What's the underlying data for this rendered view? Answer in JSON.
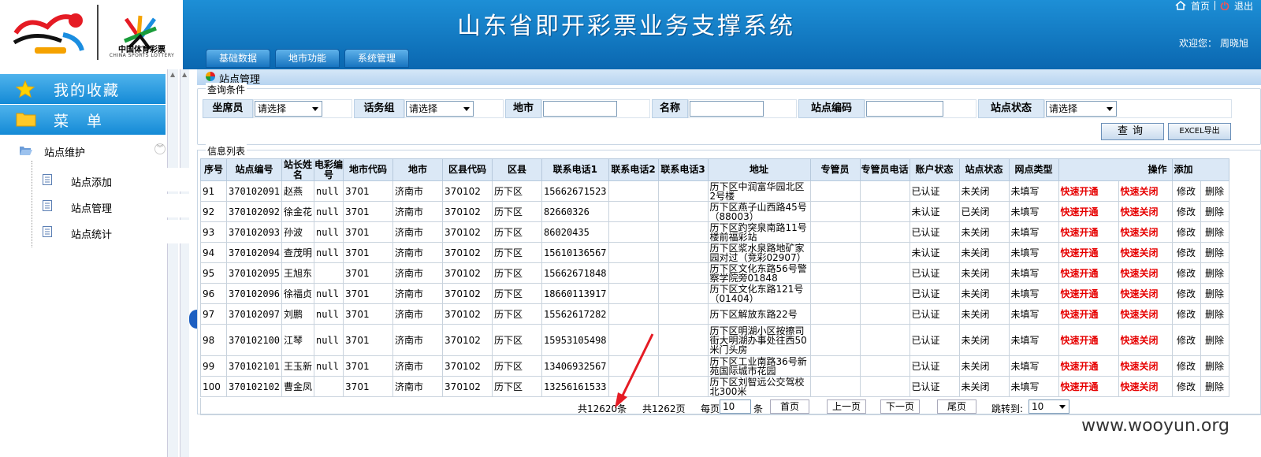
{
  "header": {
    "title": "山东省即开彩票业务支撑系统",
    "home_label": "首页",
    "logout_label": "退出",
    "welcome_label": "欢迎您：",
    "username": "周晓旭",
    "logo_cn": "中国体育彩票",
    "logo_en": "CHINA SPORTS LOTTERY",
    "tabs": [
      "基础数据",
      "地市功能",
      "系统管理"
    ]
  },
  "sidebar": {
    "favorites_label": "我的收藏",
    "menu_label": "菜　单",
    "group_label": "站点维护",
    "items": [
      "站点添加",
      "站点管理",
      "站点统计"
    ]
  },
  "page": {
    "title": "站点管理"
  },
  "query": {
    "legend": "查询条件",
    "seat_label": "坐席员",
    "seat_value": "请选择",
    "group_label": "话务组",
    "group_value": "请选择",
    "city_label": "地市",
    "name_label": "名称",
    "code_label": "站点编码",
    "status_label": "站点状态",
    "status_value": "请选择",
    "query_btn": "查询",
    "excel_btn": "EXCEL导出"
  },
  "list": {
    "legend": "信息列表",
    "columns": [
      "序号",
      "站点编号",
      "站长姓名",
      "电彩编号",
      "地市代码",
      "地市",
      "区县代码",
      "区县",
      "联系电话1",
      "联系电话2",
      "联系电话3",
      "地址",
      "专管员",
      "专管员电话",
      "账户状态",
      "站点状态",
      "网点类型",
      "操作",
      "添加"
    ],
    "rows": [
      [
        "91",
        "370102091",
        "赵燕",
        "null",
        "3701",
        "济南市",
        "370102",
        "历下区",
        "15662671523",
        "",
        "",
        "历下区中润富华园北区2号楼",
        "",
        "",
        "已认证",
        "未关闭",
        "未填写"
      ],
      [
        "92",
        "370102092",
        "徐金花",
        "null",
        "3701",
        "济南市",
        "370102",
        "历下区",
        "82660326",
        "",
        "",
        "历下区燕子山西路45号（88003）",
        "",
        "",
        "未认证",
        "已关闭",
        "未填写"
      ],
      [
        "93",
        "370102093",
        "孙波",
        "null",
        "3701",
        "济南市",
        "370102",
        "历下区",
        "86020435",
        "",
        "",
        "历下区趵突泉南路11号楼前福彩站",
        "",
        "",
        "已认证",
        "未关闭",
        "未填写"
      ],
      [
        "94",
        "370102094",
        "查茂明",
        "null",
        "3701",
        "济南市",
        "370102",
        "历下区",
        "15610136567",
        "",
        "",
        "历下区浆水泉路地矿家园对过（竞彩02907）",
        "",
        "",
        "未认证",
        "未关闭",
        "未填写"
      ],
      [
        "95",
        "370102095",
        "王旭东",
        "",
        "3701",
        "济南市",
        "370102",
        "历下区",
        "15662671848",
        "",
        "",
        "历下区文化东路56号警察学院旁01848",
        "",
        "",
        "已认证",
        "未关闭",
        "未填写"
      ],
      [
        "96",
        "370102096",
        "徐福贞",
        "null",
        "3701",
        "济南市",
        "370102",
        "历下区",
        "18660113917",
        "",
        "",
        "历下区文化东路121号（01404）",
        "",
        "",
        "已认证",
        "未关闭",
        "未填写"
      ],
      [
        "97",
        "370102097",
        "刘鹏",
        "null",
        "3701",
        "济南市",
        "370102",
        "历下区",
        "15562617282",
        "",
        "",
        "历下区解放东路22号",
        "",
        "",
        "已认证",
        "未关闭",
        "未填写"
      ],
      [
        "98",
        "370102100",
        "江琴",
        "null",
        "3701",
        "济南市",
        "370102",
        "历下区",
        "15953105498",
        "",
        "",
        "历下区明湖小区按擦司街大明湖办事处往西50米门头房",
        "",
        "",
        "已认证",
        "未关闭",
        "未填写"
      ],
      [
        "99",
        "370102101",
        "王玉新",
        "null",
        "3701",
        "济南市",
        "370102",
        "历下区",
        "13406932567",
        "",
        "",
        "历下区工业南路36号新苑国际城市花园",
        "",
        "",
        "已认证",
        "未关闭",
        "未填写"
      ],
      [
        "100",
        "370102102",
        "曹金凤",
        "",
        "3701",
        "济南市",
        "370102",
        "历下区",
        "13256161533",
        "",
        "",
        "历下区刘智远公交驾校北300米",
        "",
        "",
        "已认证",
        "未关闭",
        "未填写"
      ]
    ],
    "actions": [
      "快速开通",
      "快速关闭",
      "修改",
      "删除"
    ]
  },
  "pager": {
    "total_records": "共12620条",
    "total_pages": "共1262页",
    "per_page_label": "每页",
    "per_page_value": "10",
    "per_page_unit": "条",
    "first": "首页",
    "prev": "上一页",
    "next": "下一页",
    "last": "尾页",
    "jump_label": "跳转到:",
    "jump_value": "10"
  },
  "watermark": "www.wooyun.org"
}
